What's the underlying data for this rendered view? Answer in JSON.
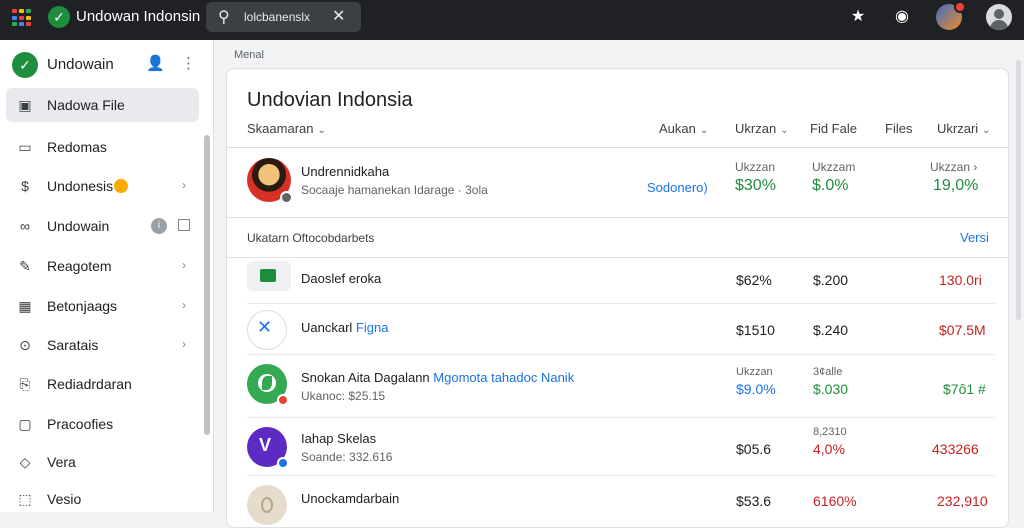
{
  "app": {
    "title": "Undowan Indonsin",
    "logo_glyph": "✓",
    "search_text": "lolcbanenslx",
    "colors": {
      "brand_green": "#1e8e3e",
      "link_blue": "#1a73e8",
      "loss_red": "#c5221f",
      "topbar": "#202124"
    }
  },
  "topbar_icons": [
    "star-icon",
    "pin-icon",
    "avatar",
    "account-icon"
  ],
  "sidebar": {
    "title": "Undowain",
    "items": [
      {
        "label": "Nadowa File",
        "icon": "photo-icon",
        "active": true
      },
      {
        "label": "Redomas",
        "icon": "document-icon"
      },
      {
        "label": "Undonesis",
        "icon": "dollar-icon",
        "badge": true,
        "chevron": "›"
      },
      {
        "label": "Undowain",
        "icon": "link-icon",
        "info": "i"
      },
      {
        "label": "Reagotem",
        "icon": "edit-icon",
        "chevron": "›"
      },
      {
        "label": "Betonjaags",
        "icon": "calendar-icon",
        "chevron": "›"
      },
      {
        "label": "Saratais",
        "icon": "dollar-circle-icon",
        "chevron": "›"
      },
      {
        "label": "Rediadrdaran",
        "icon": "receipt-icon"
      },
      {
        "label": "Pracoofies",
        "icon": "doc-icon"
      },
      {
        "label": "Vera",
        "icon": "gem-icon"
      },
      {
        "label": "Vesio",
        "icon": "box-icon"
      }
    ]
  },
  "main": {
    "breadcrumb": "Menal",
    "title": "Undovian Indonsia",
    "filters": [
      "Skaamaran",
      "Aukan",
      "Ukrzan",
      "Fid Fale",
      "Files",
      "Ukrzari"
    ],
    "hero": {
      "name": "Undrennidkaha",
      "sub": "Socaaje hamanekan Idarage · 3ola",
      "link": "Sodonero)",
      "stats": [
        {
          "label": "Ukzzan",
          "value": "$30%"
        },
        {
          "label": "Ukzzam",
          "value": "$.0%"
        },
        {
          "label": "Ukzzan ›",
          "value": "19,0%"
        }
      ]
    },
    "section_title": "Ukatarn Oftocobdarbets",
    "section_link": "Versi",
    "rows": [
      {
        "name": "Daoslef eroka",
        "name_blue": "",
        "sub": "",
        "icon": "sheet-icon",
        "c1": "$62%",
        "c2": "$.200",
        "c3": "130.0ri",
        "l1": "",
        "l2": "",
        "c3_color": "red"
      },
      {
        "name": "Uanckarl",
        "name_blue": "Figna",
        "sub": "",
        "icon": "blue-x-icon",
        "c1": "$1510",
        "c2": "$.240",
        "c3": "$07.5M",
        "l1": "",
        "l2": "",
        "c3_color": "red"
      },
      {
        "name": "Snokan Aita Dagalann",
        "name_blue": "Mgomota tahadoc Nanik",
        "sub": "Ukanoc: $25.15",
        "icon": "green-leaf-icon",
        "c1": "$9.0%",
        "c2": "$.030",
        "c3": "$7ô1 #",
        "l1": "Ukzzan",
        "l2": "3¢alle",
        "c3_color": "green"
      },
      {
        "name": "Iahap Skelas",
        "name_blue": "",
        "sub": "Soande: 332.616",
        "icon": "purple-v-icon",
        "c1": "$05.6",
        "c2": "4,0%",
        "c3": "433266",
        "l1": "",
        "l2": "8,2310",
        "c3_color": "red"
      },
      {
        "name": "Unockamdarbain",
        "name_blue": "",
        "sub": "",
        "icon": "beige-icon",
        "c1": "$53.6",
        "c2": "6160%",
        "c3": "232,910",
        "l1": "",
        "l2": "",
        "c3_color": "red"
      }
    ]
  }
}
